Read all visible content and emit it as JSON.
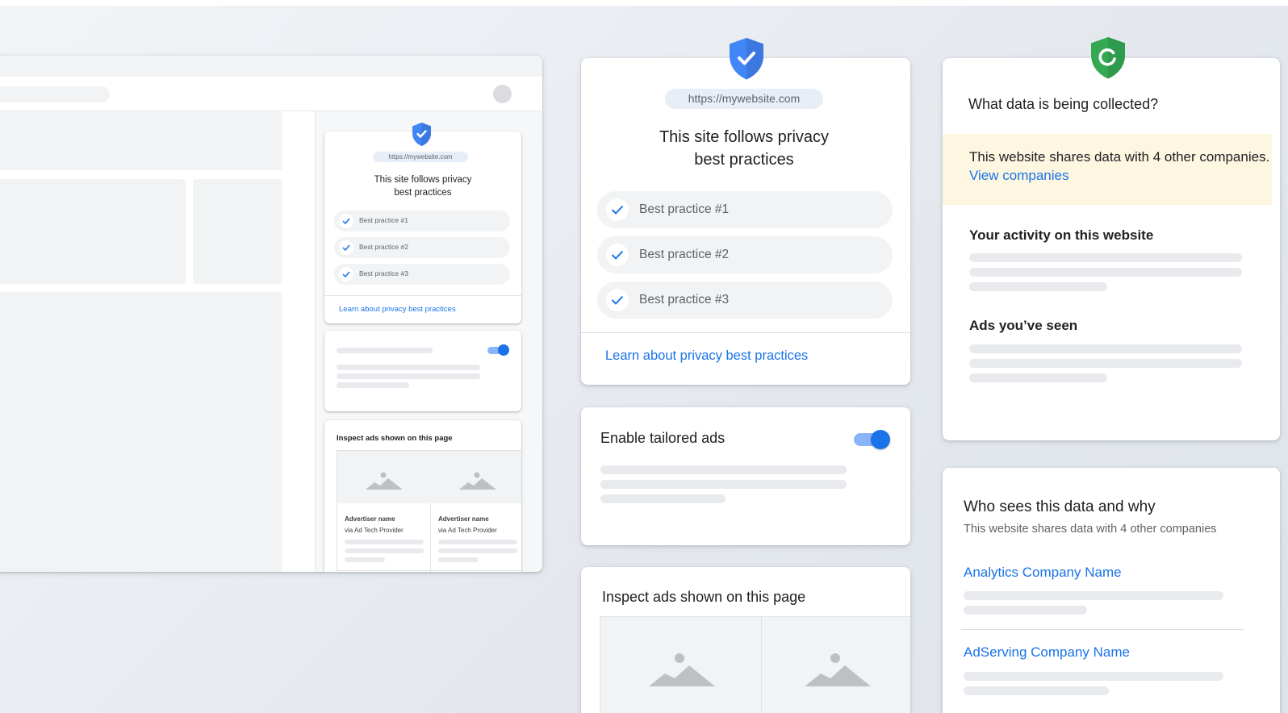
{
  "mini_panel": {
    "url": "https://mywebsite.com",
    "title_line1": "This site follows privacy",
    "title_line2": "best practices",
    "practices": [
      "Best practice #1",
      "Best practice #2",
      "Best practice #3"
    ],
    "learn_link": "Learn about privacy best practices",
    "ads_title": "Inspect ads shown on this page",
    "ads": [
      {
        "advertiser": "Advertiser name",
        "via": "via Ad Tech Provider"
      },
      {
        "advertiser": "Advertiser name",
        "via": "via Ad Tech Provider"
      }
    ]
  },
  "privacy_card": {
    "url": "https://mywebsite.com",
    "title_line1": "This site follows privacy",
    "title_line2": "best practices",
    "practices": [
      "Best practice #1",
      "Best practice #2",
      "Best practice #3"
    ],
    "learn_link": "Learn about privacy best practices"
  },
  "ads_toggle_card": {
    "label": "Enable tailored ads",
    "toggle_on": true
  },
  "inspect_ads_card": {
    "title": "Inspect ads shown on this page"
  },
  "data_card": {
    "title": "What data is being collected?",
    "notice_text": "This website shares data with 4 other companies.",
    "notice_link": "View companies",
    "section_activity": "Your activity on this website",
    "section_ads": "Ads you’ve seen"
  },
  "who_card": {
    "title": "Who sees this data and why",
    "subtitle": "This website shares data with 4 other companies",
    "companies": [
      "Analytics Company Name",
      "AdServing Company Name"
    ]
  },
  "colors": {
    "accent_blue": "#1a73e8",
    "shield_blue": "#4285f4",
    "shield_green": "#34a853",
    "notice_bg": "#fdf6e0"
  }
}
